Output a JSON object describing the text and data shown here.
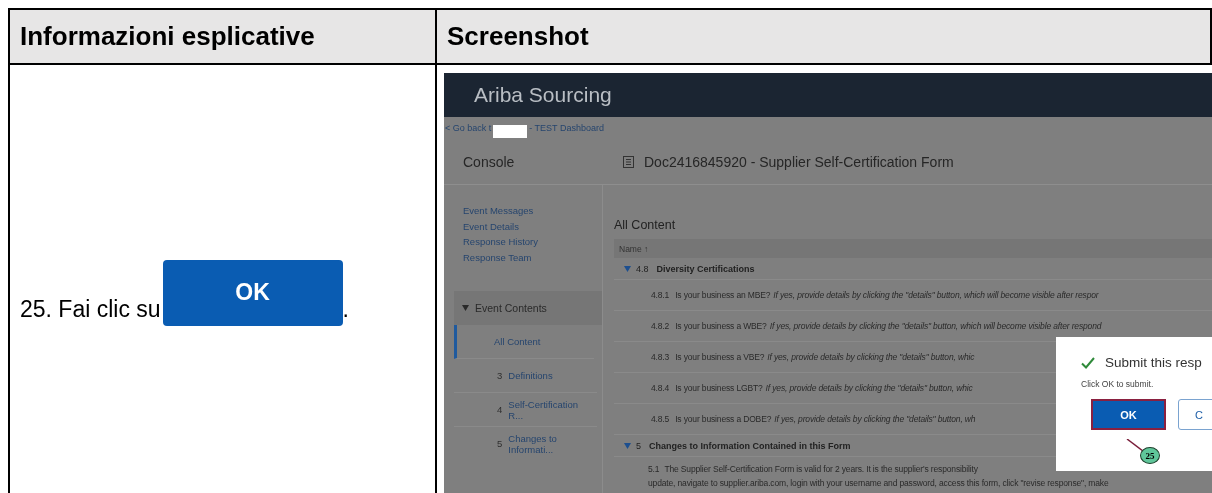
{
  "table": {
    "columns": [
      "Informazioni esplicative",
      "Screenshot"
    ],
    "instruction": {
      "before": "25. Fai clic su",
      "button_label": "OK",
      "after": "."
    },
    "screenshot": {
      "app_title": "Ariba Sourcing",
      "back_link": {
        "before": "< Go back t",
        "after": "- TEST Dashboard"
      },
      "console_title": "Console",
      "document_title": "Doc2416845920 - Supplier Self-Certification Form",
      "console_links": [
        "Event Messages",
        "Event Details",
        "Response History",
        "Response Team"
      ],
      "event_contents": {
        "label": "Event Contents",
        "expanded": true
      },
      "nav_items": [
        {
          "label": "All Content",
          "selected": true
        },
        {
          "number": "3",
          "label": "Definitions",
          "selected": false
        },
        {
          "number": "4",
          "label": "Self-Certification R...",
          "selected": false
        },
        {
          "number": "5",
          "label": "Changes to Informati...",
          "selected": false
        }
      ],
      "section_title": "All Content",
      "column_header": "Name ↑",
      "rows": [
        {
          "kind": "group",
          "number": "4.8",
          "label": "Diversity Certifications"
        },
        {
          "kind": "question",
          "number": "4.8.1",
          "question": "Is your business an MBE?",
          "hint": "If yes, provide details by clicking the \"details\" button, which will become visible after respor"
        },
        {
          "kind": "question",
          "number": "4.8.2",
          "question": "Is your business a WBE?",
          "hint": "If yes, provide details by clicking the \"details\" button, which will become visible after respond"
        },
        {
          "kind": "question",
          "number": "4.8.3",
          "question": "Is your business a VBE?",
          "hint": "If yes, provide details by clicking the \"details\" button, whic"
        },
        {
          "kind": "question",
          "number": "4.8.4",
          "question": "Is your business LGBT?",
          "hint": "If yes, provide details by clicking the \"details\" button, whic"
        },
        {
          "kind": "question",
          "number": "4.8.5",
          "question": "Is your business a DOBE?",
          "hint": "If yes, provide details by clicking the \"details\" button, wh"
        },
        {
          "kind": "group",
          "number": "5",
          "label": "Changes to Information Contained in this Form"
        },
        {
          "kind": "paragraph",
          "number": "5.1",
          "lines": [
            "The Supplier Self-Certification Form is valid for 2 years. It is the supplier's responsibility",
            "update, navigate to supplier.ariba.com, login with your username and password, access this form, click \"revise response\", make"
          ]
        }
      ],
      "dialog": {
        "title": "Submit this resp",
        "message": "Click OK to submit.",
        "ok_label": "OK",
        "cancel_label": "C",
        "callout": "25"
      }
    }
  }
}
